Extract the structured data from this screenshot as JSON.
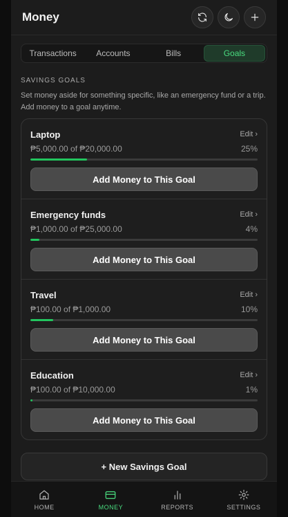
{
  "header": {
    "title": "Money",
    "actions": [
      {
        "icon": "sync-icon"
      },
      {
        "icon": "moon-icon"
      },
      {
        "icon": "plus-icon"
      }
    ]
  },
  "tabs": [
    {
      "label": "Transactions",
      "active": false
    },
    {
      "label": "Accounts",
      "active": false
    },
    {
      "label": "Bills",
      "active": false
    },
    {
      "label": "Goals",
      "active": true
    }
  ],
  "section": {
    "label": "SAVINGS GOALS",
    "description": "Set money aside for something specific, like an emergency fund or a trip. Add money to a goal anytime."
  },
  "goals": [
    {
      "name": "Laptop",
      "edit_label": "Edit ›",
      "amount": "₱5,000.00 of ₱20,000.00",
      "percent_label": "25%",
      "progress": 0.25,
      "add_label": "Add Money to This Goal"
    },
    {
      "name": "Emergency funds",
      "edit_label": "Edit ›",
      "amount": "₱1,000.00 of ₱25,000.00",
      "percent_label": "4%",
      "progress": 0.04,
      "add_label": "Add Money to This Goal"
    },
    {
      "name": "Travel",
      "edit_label": "Edit ›",
      "amount": "₱100.00 of ₱1,000.00",
      "percent_label": "10%",
      "progress": 0.1,
      "add_label": "Add Money to This Goal"
    },
    {
      "name": "Education",
      "edit_label": "Edit ›",
      "amount": "₱100.00 of ₱10,000.00",
      "percent_label": "1%",
      "progress": 0.01,
      "add_label": "Add Money to This Goal"
    }
  ],
  "new_goal_label": "+ New Savings Goal",
  "nav": [
    {
      "label": "HOME",
      "icon": "home-icon",
      "active": false
    },
    {
      "label": "MONEY",
      "icon": "wallet-icon",
      "active": true
    },
    {
      "label": "REPORTS",
      "icon": "bar-chart-icon",
      "active": false
    },
    {
      "label": "SETTINGS",
      "icon": "gear-icon",
      "active": false
    }
  ],
  "colors": {
    "accent": "#4ade80",
    "progress": "#22c55e",
    "background": "#1c1c1c"
  }
}
